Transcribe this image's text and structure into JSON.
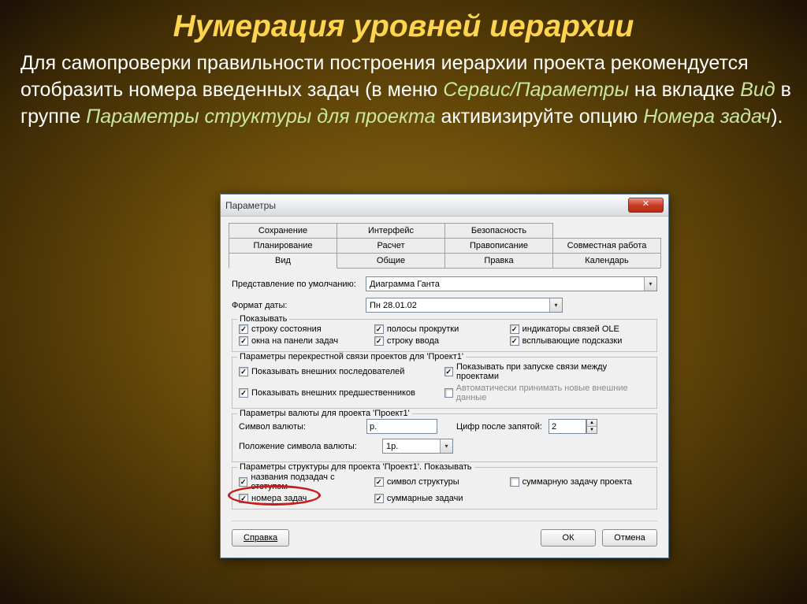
{
  "slide": {
    "title": "Нумерация уровней иерархии",
    "text_parts": {
      "p1": "Для самопроверки правильности построения иерархии проекта рекомендуется отобразить номера введенных задач (в меню ",
      "m1": "Сервис/Параметры",
      "p2": " на вкладке ",
      "m2": "Вид",
      "p3": " в группе ",
      "m3": "Параметры структуры для проекта",
      "p4": " активизируйте опцию ",
      "m4": "Номера задач",
      "p5": ")."
    }
  },
  "dialog": {
    "title": "Параметры",
    "close": "✕",
    "tabs_row1": [
      "Сохранение",
      "Интерфейс",
      "Безопасность",
      ""
    ],
    "tabs_row2": [
      "Планирование",
      "Расчет",
      "Правописание",
      "Совместная работа"
    ],
    "tabs_row3": [
      "Вид",
      "Общие",
      "Правка",
      "Календарь"
    ],
    "default_view_label": "Представление по умолчанию:",
    "default_view_value": "Диаграмма Ганта",
    "date_format_label": "Формат даты:",
    "date_format_value": "Пн 28.01.02",
    "groups": {
      "show": {
        "title": "Показывать",
        "items": [
          {
            "label": "строку состояния",
            "checked": true
          },
          {
            "label": "полосы прокрутки",
            "checked": true
          },
          {
            "label": "индикаторы связей OLE",
            "checked": true
          },
          {
            "label": "окна на панели задач",
            "checked": true
          },
          {
            "label": "строку ввода",
            "checked": true
          },
          {
            "label": "всплывающие подсказки",
            "checked": true
          }
        ]
      },
      "cross": {
        "title": "Параметры перекрестной связи проектов для 'Проект1'",
        "items": [
          {
            "label": "Показывать внешних последователей",
            "checked": true
          },
          {
            "label": "Показывать при запуске связи между проектами",
            "checked": true
          },
          {
            "label": "Показывать внешних предшественников",
            "checked": true
          },
          {
            "label": "Автоматически принимать новые внешние данные",
            "checked": false,
            "disabled": true
          }
        ]
      },
      "currency": {
        "title": "Параметры валюты для проекта 'Проект1'",
        "symbol_label": "Символ валюты:",
        "symbol_value": "р.",
        "digits_label": "Цифр после запятой:",
        "digits_value": "2",
        "position_label": "Положение символа валюты:",
        "position_value": "1р."
      },
      "outline": {
        "title": "Параметры структуры для проекта 'Проект1'. Показывать",
        "items": [
          {
            "label": "названия подзадач с отступом",
            "checked": true
          },
          {
            "label": "символ структуры",
            "checked": true
          },
          {
            "label": "суммарную задачу проекта",
            "checked": false
          },
          {
            "label": "номера задач",
            "checked": true
          },
          {
            "label": "суммарные задачи",
            "checked": true
          }
        ]
      }
    },
    "buttons": {
      "help": "Справка",
      "ok": "ОК",
      "cancel": "Отмена"
    }
  }
}
